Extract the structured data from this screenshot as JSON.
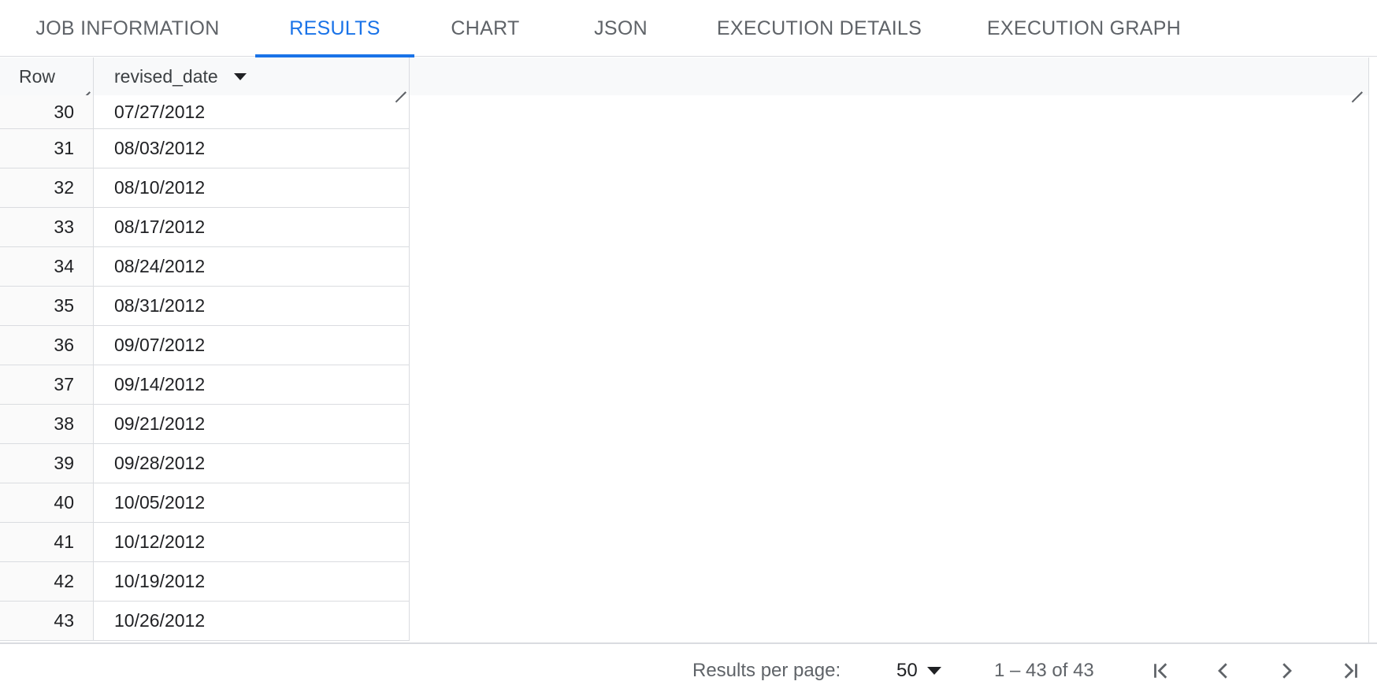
{
  "tabs": [
    {
      "label": "JOB INFORMATION",
      "active": false
    },
    {
      "label": "RESULTS",
      "active": true
    },
    {
      "label": "CHART",
      "active": false
    },
    {
      "label": "JSON",
      "active": false
    },
    {
      "label": "EXECUTION DETAILS",
      "active": false
    },
    {
      "label": "EXECUTION GRAPH",
      "active": false
    }
  ],
  "table": {
    "columns": [
      "Row",
      "revised_date"
    ],
    "rows": [
      {
        "row": "30",
        "revised_date": "07/27/2012"
      },
      {
        "row": "31",
        "revised_date": "08/03/2012"
      },
      {
        "row": "32",
        "revised_date": "08/10/2012"
      },
      {
        "row": "33",
        "revised_date": "08/17/2012"
      },
      {
        "row": "34",
        "revised_date": "08/24/2012"
      },
      {
        "row": "35",
        "revised_date": "08/31/2012"
      },
      {
        "row": "36",
        "revised_date": "09/07/2012"
      },
      {
        "row": "37",
        "revised_date": "09/14/2012"
      },
      {
        "row": "38",
        "revised_date": "09/21/2012"
      },
      {
        "row": "39",
        "revised_date": "09/28/2012"
      },
      {
        "row": "40",
        "revised_date": "10/05/2012"
      },
      {
        "row": "41",
        "revised_date": "10/12/2012"
      },
      {
        "row": "42",
        "revised_date": "10/19/2012"
      },
      {
        "row": "43",
        "revised_date": "10/26/2012"
      }
    ]
  },
  "pagination": {
    "per_page_label": "Results per page:",
    "per_page_value": "50",
    "range_text": "1 – 43 of 43"
  },
  "colors": {
    "accent": "#1a73e8",
    "tab_text": "#5f6368",
    "border": "#dadce0",
    "header_bg": "#f8f9fa"
  }
}
